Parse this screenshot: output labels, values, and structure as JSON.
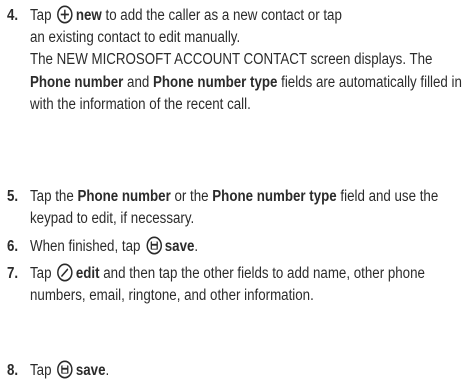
{
  "steps": [
    {
      "number": "4.",
      "line1_before": "Tap",
      "line1_bold": "new",
      "line1_after": "to add the caller as a new contact or tap",
      "line2": "an existing contact to edit manually.",
      "para2_a": "The NEW MICROSOFT ACCOUNT CONTACT screen displays. The",
      "para2_b": "Phone number",
      "para2_c": "and",
      "para2_d": "Phone number type",
      "para2_e": "fields are automatically filled in with the information of the recent call.",
      "icon": "add-circle-icon"
    },
    {
      "number": "5.",
      "a": "Tap the",
      "b": "Phone number",
      "c": "or the",
      "d": "Phone number type",
      "e": "field and use the keypad to edit, if necessary."
    },
    {
      "number": "6.",
      "a": "When finished, tap",
      "b": "save",
      "c": ".",
      "icon": "save-circle-icon"
    },
    {
      "number": "7.",
      "a": "Tap",
      "b": "edit",
      "c": "and then tap the other fields to add name, other phone numbers, email, ringtone, and other information.",
      "icon": "edit-circle-icon"
    },
    {
      "number": "8.",
      "a": "Tap",
      "b": "save",
      "c": ".",
      "icon": "save-circle-icon"
    }
  ]
}
